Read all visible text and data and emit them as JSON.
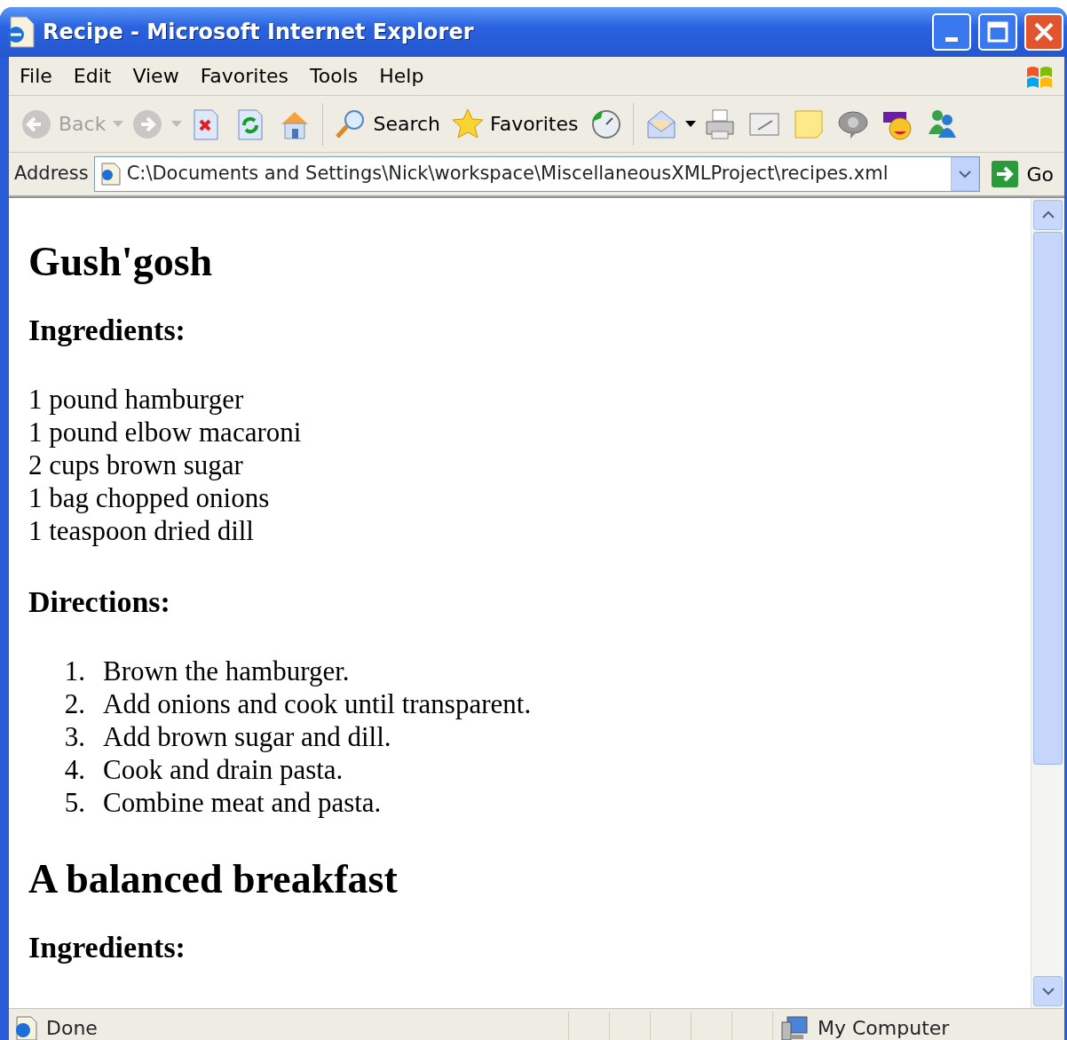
{
  "window": {
    "title": "Recipe - Microsoft Internet Explorer"
  },
  "menu": [
    "File",
    "Edit",
    "View",
    "Favorites",
    "Tools",
    "Help"
  ],
  "toolbar": [
    {
      "kind": "back",
      "label": "Back",
      "disabled": true,
      "dropdown": true
    },
    {
      "kind": "forward",
      "disabled": true,
      "dropdown": true
    },
    {
      "kind": "stop",
      "disabled": false
    },
    {
      "kind": "refresh",
      "disabled": false
    },
    {
      "kind": "home",
      "disabled": false
    },
    {
      "kind": "search",
      "label": "Search",
      "disabled": false
    },
    {
      "kind": "favorites",
      "label": "Favorites",
      "disabled": false
    },
    {
      "kind": "history",
      "disabled": false
    },
    {
      "kind": "mail",
      "disabled": false,
      "dropdown": true
    },
    {
      "kind": "print",
      "disabled": false
    },
    {
      "kind": "edit",
      "disabled": false
    },
    {
      "kind": "note",
      "disabled": false
    },
    {
      "kind": "chat",
      "disabled": false
    },
    {
      "kind": "smiley",
      "disabled": false
    },
    {
      "kind": "people",
      "disabled": false
    }
  ],
  "address": {
    "label": "Address",
    "value": "C:\\Documents and Settings\\Nick\\workspace\\MiscellaneousXMLProject\\recipes.xml",
    "go": "Go"
  },
  "recipes": [
    {
      "title": "Gush'gosh",
      "ingredients_heading": "Ingredients:",
      "ingredients": [
        "1 pound hamburger",
        "1 pound elbow macaroni",
        "2 cups brown sugar",
        "1 bag chopped onions",
        "1 teaspoon dried dill"
      ],
      "directions_heading": "Directions:",
      "directions": [
        {
          "number": "1.",
          "text": "Brown the hamburger."
        },
        {
          "number": "2.",
          "text": "Add onions and cook until transparent."
        },
        {
          "number": "3.",
          "text": "Add brown sugar and dill."
        },
        {
          "number": "4.",
          "text": "Cook and drain pasta."
        },
        {
          "number": "5.",
          "text": "Combine meat and pasta."
        }
      ]
    },
    {
      "title": "A balanced breakfast",
      "ingredients_heading": "Ingredients:"
    }
  ],
  "status_bar": {
    "text": "Done",
    "zone": "My Computer"
  }
}
